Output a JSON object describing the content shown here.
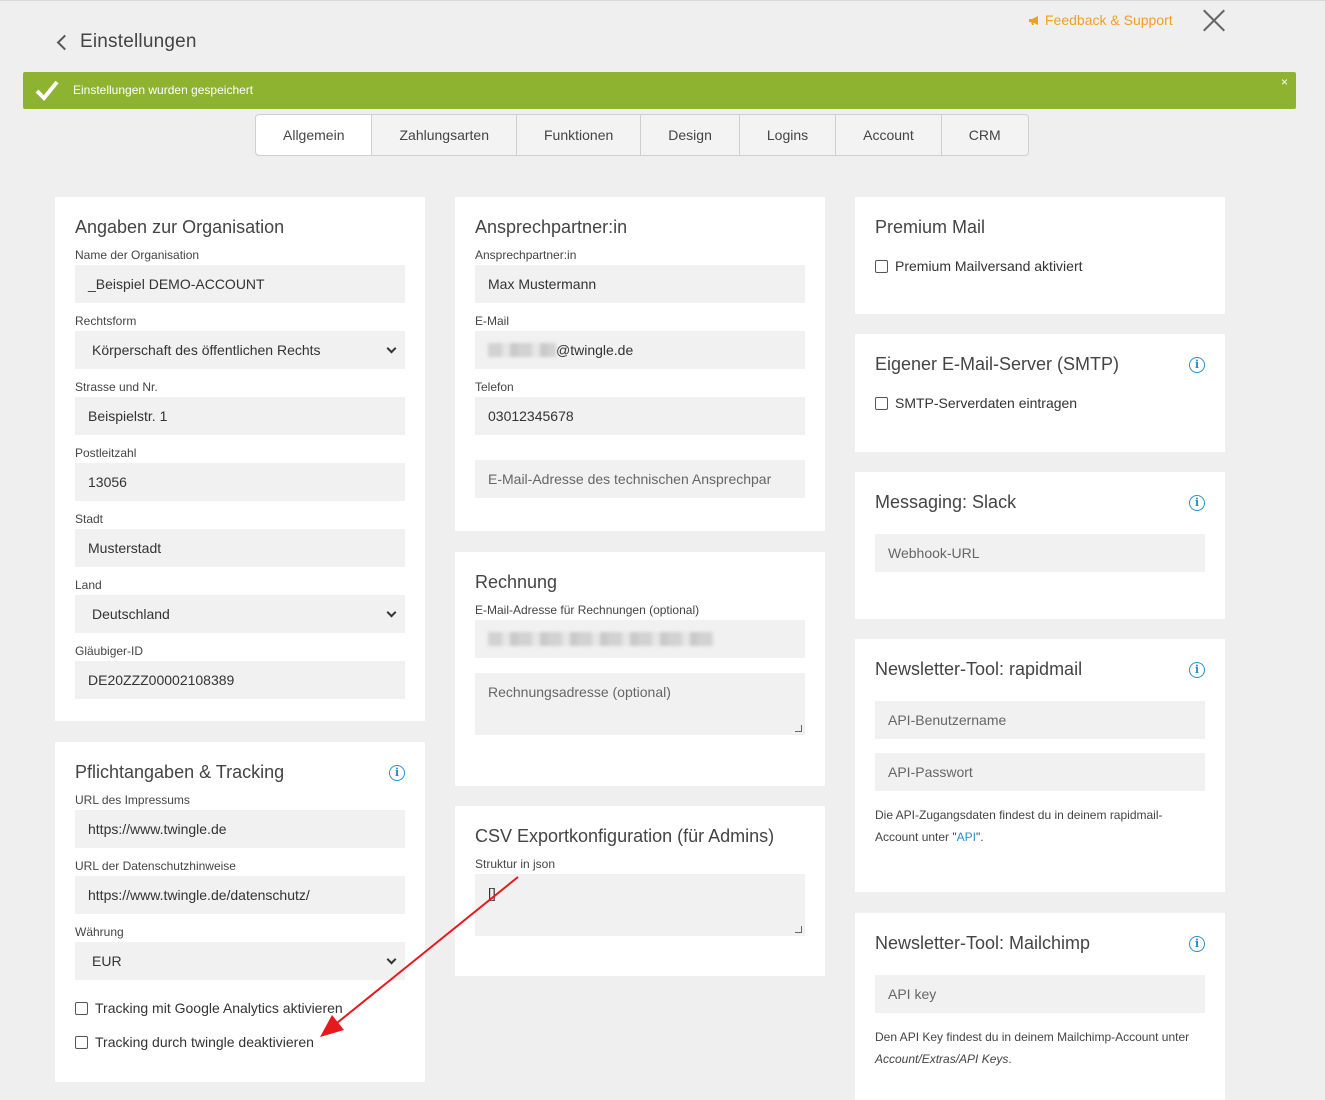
{
  "header": {
    "back_label": "Einstellungen",
    "feedback_label": "Feedback & Support"
  },
  "alert": {
    "message": "Einstellungen wurden gespeichert",
    "close": "×"
  },
  "tabs": [
    "Allgemein",
    "Zahlungsarten",
    "Funktionen",
    "Design",
    "Logins",
    "Account",
    "CRM"
  ],
  "org": {
    "title": "Angaben zur Organisation",
    "name_label": "Name der Organisation",
    "name_value": "_Beispiel DEMO-ACCOUNT",
    "form_label": "Rechtsform",
    "form_value": "Körperschaft des öffentlichen Rechts",
    "street_label": "Strasse und Nr.",
    "street_value": "Beispielstr. 1",
    "zip_label": "Postleitzahl",
    "zip_value": "13056",
    "city_label": "Stadt",
    "city_value": "Musterstadt",
    "country_label": "Land",
    "country_value": "Deutschland",
    "creditor_label": "Gläubiger-ID",
    "creditor_value": "DE20ZZZ00002108389"
  },
  "tracking": {
    "title": "Pflichtangaben & Tracking",
    "imprint_label": "URL des Impressums",
    "imprint_value": "https://www.twingle.de",
    "privacy_label": "URL der Datenschutzhinweise",
    "privacy_value": "https://www.twingle.de/datenschutz/",
    "currency_label": "Währung",
    "currency_value": "EUR",
    "ga_label": "Tracking mit Google Analytics aktivieren",
    "twingle_label": "Tracking durch twingle deaktivieren"
  },
  "contact": {
    "title": "Ansprechpartner:in",
    "person_label": "Ansprechpartner:in",
    "person_value": "Max Mustermann",
    "email_label": "E-Mail",
    "email_value": "@twingle.de",
    "phone_label": "Telefon",
    "phone_value": "03012345678",
    "tech_placeholder": "E-Mail-Adresse des technischen Ansprechpar"
  },
  "invoice": {
    "title": "Rechnung",
    "email_label": "E-Mail-Adresse für Rechnungen (optional)",
    "address_placeholder": "Rechnungsadresse (optional)"
  },
  "csv": {
    "title": "CSV Exportkonfiguration (für Admins)",
    "struct_label": "Struktur in json",
    "struct_value": "[]"
  },
  "premium": {
    "title": "Premium Mail",
    "check_label": "Premium Mailversand aktiviert"
  },
  "smtp": {
    "title": "Eigener E-Mail-Server (SMTP)",
    "check_label": "SMTP-Serverdaten eintragen"
  },
  "slack": {
    "title": "Messaging: Slack",
    "webhook_placeholder": "Webhook-URL"
  },
  "rapidmail": {
    "title": "Newsletter-Tool: rapidmail",
    "user_placeholder": "API-Benutzername",
    "pass_placeholder": "API-Passwort",
    "note_text": "Die API-Zugangsdaten findest du in deinem rapidmail-Account unter \"",
    "note_link": "API",
    "note_end": "\"."
  },
  "mailchimp": {
    "title": "Newsletter-Tool: Mailchimp",
    "key_placeholder": "API key",
    "note_text": "Den API Key findest du in deinem Mailchimp-Account unter",
    "note_path": "Account/Extras/API Keys",
    "note_end": "."
  },
  "colors": {
    "accent": "#8db331",
    "info": "#2a8fc9",
    "feedback": "#f0a020",
    "annotation_arrow": "#e8191d"
  }
}
